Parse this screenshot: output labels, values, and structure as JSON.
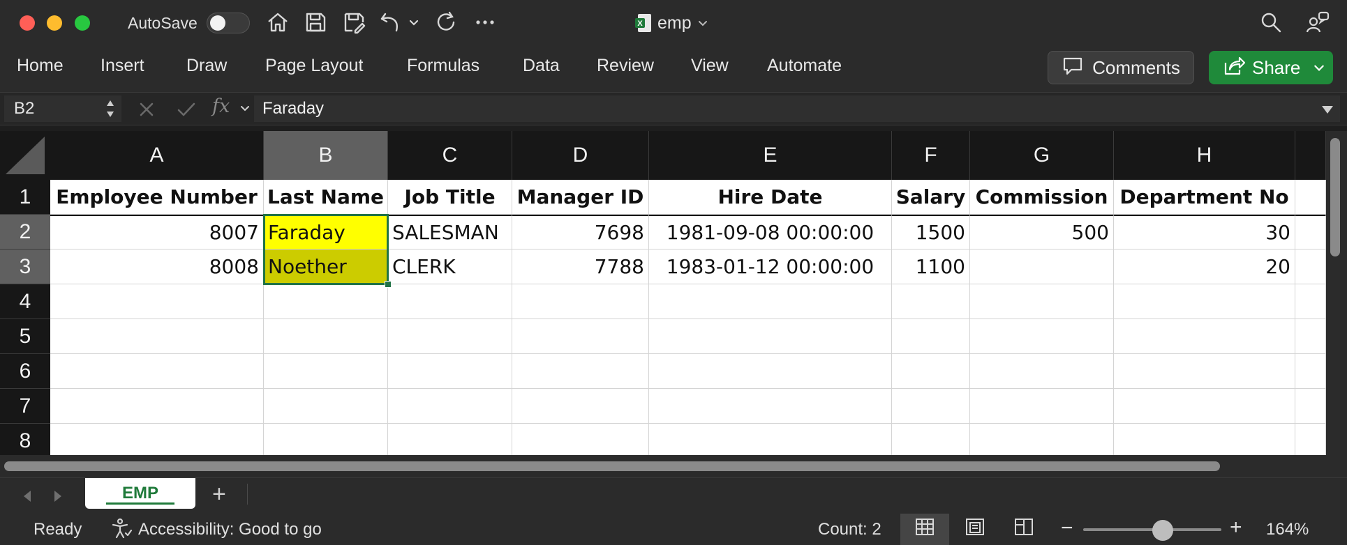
{
  "titlebar": {
    "autosave_label": "AutoSave",
    "autosave_on": false,
    "doc_title": "emp",
    "icons": [
      "home-icon",
      "save-icon",
      "save-as-icon",
      "undo-icon",
      "redo-icon",
      "more-icon",
      "search-icon",
      "share-people-icon"
    ]
  },
  "ribbon": {
    "tabs": [
      "Home",
      "Insert",
      "Draw",
      "Page Layout",
      "Formulas",
      "Data",
      "Review",
      "View",
      "Automate"
    ],
    "comments_label": "Comments",
    "share_label": "Share",
    "share_color": "#1f8a3a"
  },
  "formula_bar": {
    "name_box": "B2",
    "fx_label": "fx",
    "value": "Faraday"
  },
  "sheet": {
    "columns": [
      "A",
      "B",
      "C",
      "D",
      "E",
      "F",
      "G",
      "H"
    ],
    "selected_column": "B",
    "rows": [
      "1",
      "2",
      "3",
      "4",
      "5",
      "6",
      "7",
      "8"
    ],
    "headers": [
      "Employee Number",
      "Last Name",
      "Job Title",
      "Manager ID",
      "Hire Date",
      "Salary",
      "Commission",
      "Department No"
    ],
    "data": [
      [
        "8007",
        "Faraday",
        "SALESMAN",
        "7698",
        "1981-09-08 00:00:00",
        "1500",
        "500",
        "30"
      ],
      [
        "8008",
        "Noether",
        "CLERK",
        "7788",
        "1983-01-12 00:00:00",
        "1100",
        "",
        "20"
      ]
    ],
    "highlight_colors": {
      "active": "#ffff00",
      "range": "#cccc00"
    },
    "selection_color": "#217346"
  },
  "sheet_tabs": {
    "active": "EMP",
    "add_label": "+"
  },
  "statusbar": {
    "ready": "Ready",
    "accessibility": "Accessibility: Good to go",
    "count": "Count: 2",
    "zoom": "164%",
    "zoom_minus": "−",
    "zoom_plus": "+"
  }
}
